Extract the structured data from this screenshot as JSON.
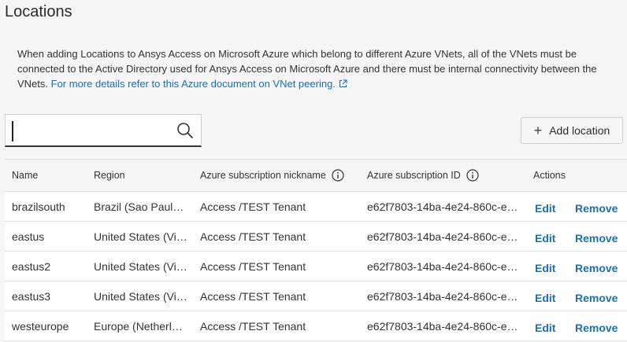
{
  "page": {
    "title": "Locations"
  },
  "info": {
    "text": "When adding Locations to Ansys Access on Microsoft Azure which belong to different Azure VNets, all of the VNets must be connected to the Active Directory used for Ansys Access on Microsoft Azure and there must be internal connectivity between the VNets. ",
    "link_text": "For more details refer to this Azure document on VNet peering.",
    "link_icon": "external-link-icon"
  },
  "search": {
    "value": "",
    "placeholder": "",
    "icon": "search-icon"
  },
  "add_button": {
    "label": "Add location",
    "icon": "plus-icon"
  },
  "table": {
    "columns": {
      "name": "Name",
      "region": "Region",
      "nickname": "Azure subscription nickname",
      "subscription_id": "Azure subscription ID",
      "actions": "Actions"
    },
    "rows": [
      {
        "name": "brazilsouth",
        "region": "Brazil (Sao Paul…",
        "nickname": "Access /TEST Tenant",
        "subscription_id": "e62f7803-14ba-4e24-860c-e1…",
        "edit": "Edit",
        "remove": "Remove"
      },
      {
        "name": "eastus",
        "region": "United States (Vi…",
        "nickname": "Access /TEST Tenant",
        "subscription_id": "e62f7803-14ba-4e24-860c-e1…",
        "edit": "Edit",
        "remove": "Remove"
      },
      {
        "name": "eastus2",
        "region": "United States (Vi…",
        "nickname": "Access /TEST Tenant",
        "subscription_id": "e62f7803-14ba-4e24-860c-e1…",
        "edit": "Edit",
        "remove": "Remove"
      },
      {
        "name": "eastus3",
        "region": "United States (Vi…",
        "nickname": "Access /TEST Tenant",
        "subscription_id": "e62f7803-14ba-4e24-860c-e1…",
        "edit": "Edit",
        "remove": "Remove"
      },
      {
        "name": "westeurope",
        "region": "Europe (Netherl…",
        "nickname": "Access /TEST Tenant",
        "subscription_id": "e62f7803-14ba-4e24-860c-e1…",
        "edit": "Edit",
        "remove": "Remove"
      }
    ]
  },
  "colors": {
    "link": "#1a6fb5",
    "background": "#f5f5f5",
    "text": "#333333"
  }
}
